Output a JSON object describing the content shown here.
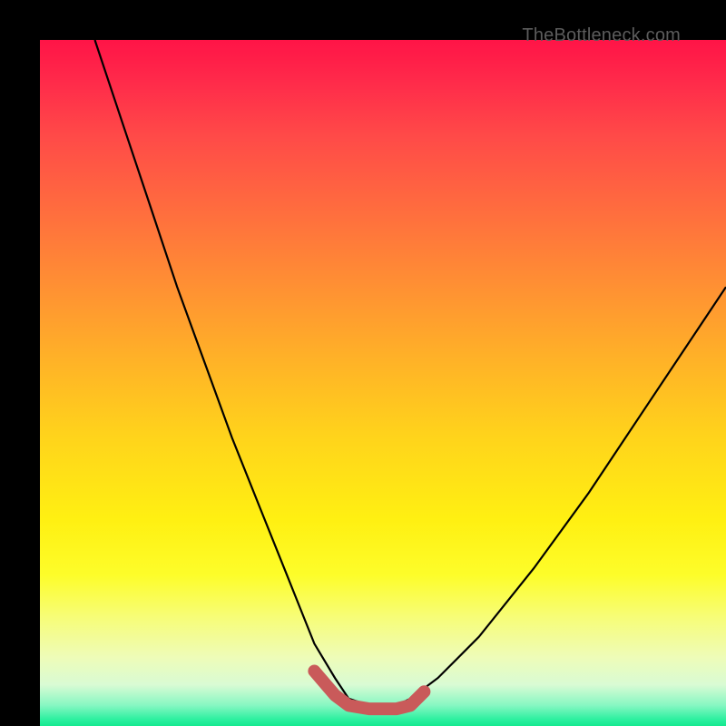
{
  "watermark": "TheBottleneck.com",
  "chart_data": {
    "type": "line",
    "title": "",
    "xlabel": "",
    "ylabel": "",
    "xlim": [
      0,
      100
    ],
    "ylim": [
      0,
      100
    ],
    "series": [
      {
        "name": "curve",
        "x": [
          8,
          12,
          16,
          20,
          24,
          28,
          32,
          36,
          38,
          40,
          43,
          45,
          48,
          52,
          54,
          58,
          64,
          72,
          80,
          88,
          96,
          100
        ],
        "values": [
          100,
          88,
          76,
          64,
          53,
          42,
          32,
          22,
          17,
          12,
          7,
          4,
          3,
          3,
          4,
          7,
          13,
          23,
          34,
          46,
          58,
          64
        ]
      },
      {
        "name": "trough-marker",
        "x": [
          40,
          43,
          45,
          48,
          52,
          54,
          56
        ],
        "values": [
          8,
          4.5,
          3,
          2.5,
          2.5,
          3,
          5
        ]
      }
    ],
    "colors": {
      "curve": "#000000",
      "trough": "#c95a5a"
    }
  }
}
